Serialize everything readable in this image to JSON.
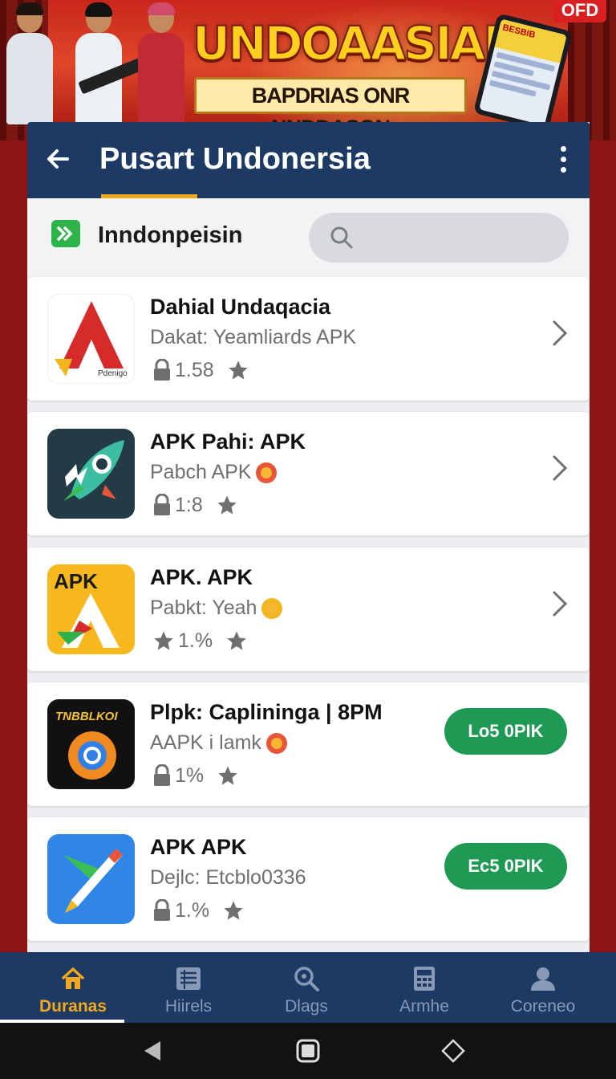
{
  "banner": {
    "title": "UNDOAASIAN",
    "subtitle": "BAPDRIAS ONR NNDDASON",
    "corner_badge": "OFD",
    "phone_text": "BESBIB"
  },
  "appbar": {
    "title": "Pusart Undonersia",
    "back_icon": "arrow-left-icon",
    "menu_icon": "more-vertical-icon"
  },
  "filter": {
    "label": "Inndonpeisin",
    "search_placeholder": ""
  },
  "apps": [
    {
      "name": "Dahial Undaqacia",
      "subtitle": "Dakat: Yeamliards APK",
      "meta": "1.58",
      "meta_icon": "lock-icon",
      "action": "chevron",
      "icon_caption": "Pdenigo"
    },
    {
      "name": "APK Pahi: APK",
      "subtitle": "Pabch APK",
      "meta": "1:8",
      "meta_icon": "lock-icon",
      "action": "chevron"
    },
    {
      "name": "APK. APK",
      "subtitle": "Pabkt: Yeah",
      "meta": "1.%",
      "meta_icon": "star-icon",
      "action": "chevron",
      "icon_caption": "APK"
    },
    {
      "name": "Plpk: Caplininga | 8PM",
      "subtitle": "AAPK i lamk",
      "meta": "1%",
      "meta_icon": "lock-icon",
      "action": "button",
      "button_label": "Lo5 0PIK",
      "icon_caption": "TNBBLKOI"
    },
    {
      "name": "APK APK",
      "subtitle": "Dejlc: Etcblo0336",
      "meta": "1.%",
      "meta_icon": "lock-icon",
      "action": "button",
      "button_label": "Ec5 0PIK"
    }
  ],
  "nav": [
    {
      "label": "Duranas",
      "icon": "home-icon",
      "active": true
    },
    {
      "label": "Hiirels",
      "icon": "list-icon",
      "active": false
    },
    {
      "label": "Dlags",
      "icon": "search-zoom-icon",
      "active": false
    },
    {
      "label": "Armhe",
      "icon": "calculator-icon",
      "active": false
    },
    {
      "label": "Coreneo",
      "icon": "user-icon",
      "active": false
    }
  ],
  "colors": {
    "appbar": "#1c3a63",
    "accent": "#f0a91e",
    "button": "#1f9a55",
    "frame": "#8e1414"
  }
}
